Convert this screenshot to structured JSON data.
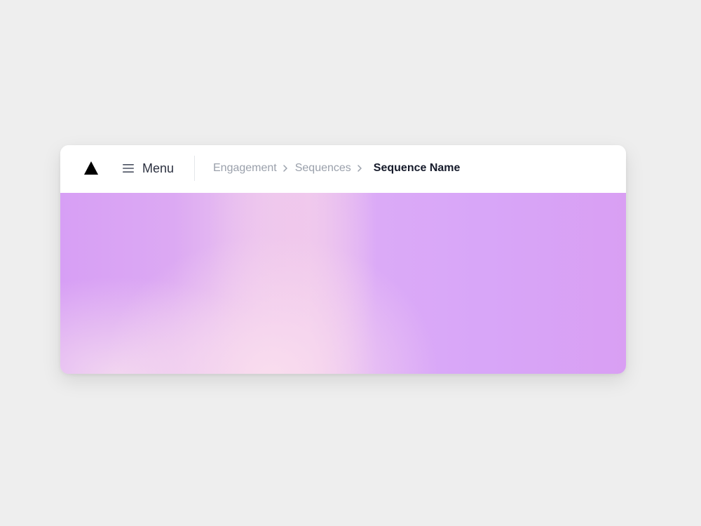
{
  "header": {
    "logo_icon": "triangle-logo-icon",
    "menu": {
      "icon": "hamburger-icon",
      "label": "Menu"
    }
  },
  "breadcrumb": {
    "items": [
      {
        "label": "Engagement"
      },
      {
        "label": "Sequences"
      }
    ],
    "current": "Sequence Name",
    "separator_icon": "chevron-right-icon"
  },
  "theme": {
    "background": "#eeeeee",
    "card": "#ffffff",
    "text_primary": "#161b2b",
    "text_muted": "#9aa0ab",
    "hero_gradient": [
      "#d79ff5",
      "#efcaee",
      "#fadeee",
      "#d8a6f8"
    ]
  }
}
